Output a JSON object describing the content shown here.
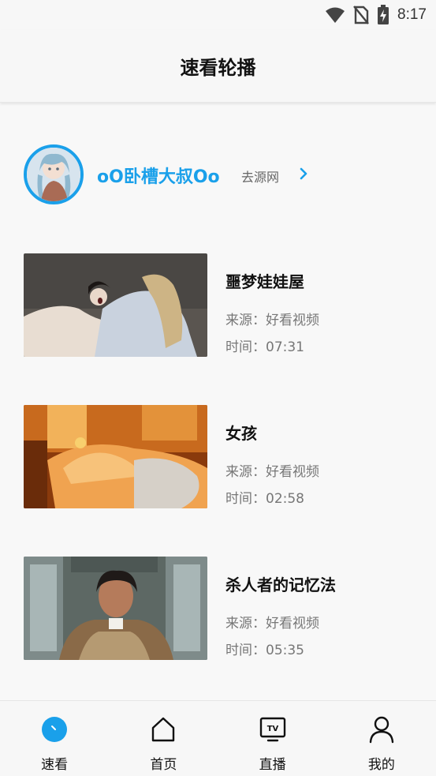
{
  "status_bar": {
    "time": "8:17"
  },
  "header": {
    "title": "速看轮播"
  },
  "profile": {
    "name": "oO卧槽大叔Oo",
    "link_label": "去源网",
    "accent_color": "#1aa0ea"
  },
  "videos": [
    {
      "title": "噩梦娃娃屋",
      "source": "来源：好看视频",
      "time": "时间：07:31"
    },
    {
      "title": "女孩",
      "source": "来源：好看视频",
      "time": "时间：02:58"
    },
    {
      "title": "杀人者的记忆法",
      "source": "来源：好看视频",
      "time": "时间：05:35"
    }
  ],
  "bottom_nav": {
    "items": [
      {
        "label": "速看",
        "icon": "quick-view-icon",
        "active": true
      },
      {
        "label": "首页",
        "icon": "home-icon",
        "active": false
      },
      {
        "label": "直播",
        "icon": "tv-icon",
        "active": false
      },
      {
        "label": "我的",
        "icon": "user-icon",
        "active": false
      }
    ]
  }
}
